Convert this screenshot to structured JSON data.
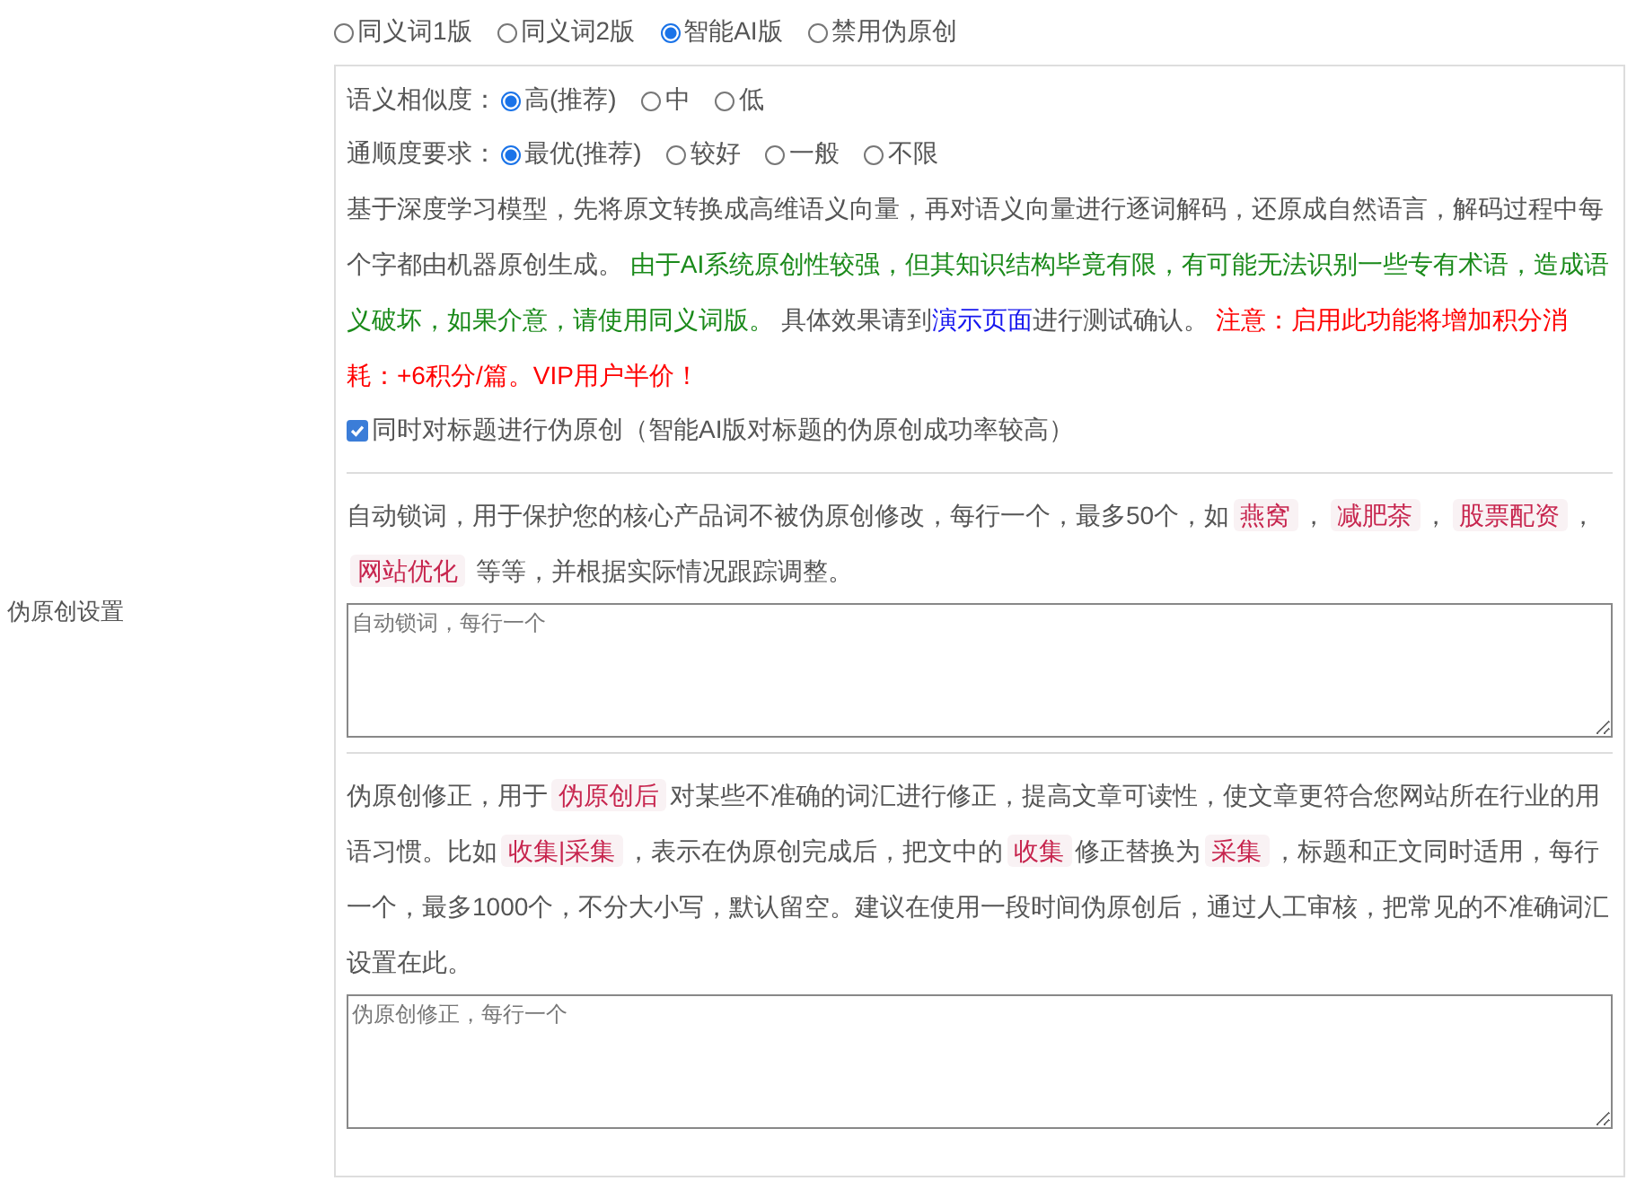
{
  "mode_options": [
    {
      "label": "同义词1版",
      "selected": false
    },
    {
      "label": "同义词2版",
      "selected": false
    },
    {
      "label": "智能AI版",
      "selected": true
    },
    {
      "label": "禁用伪原创",
      "selected": false
    }
  ],
  "section_label": "伪原创设置",
  "similarity": {
    "label": "语义相似度：",
    "options": [
      {
        "label": "高(推荐)",
        "selected": true
      },
      {
        "label": "中",
        "selected": false
      },
      {
        "label": "低",
        "selected": false
      }
    ]
  },
  "fluency": {
    "label": "通顺度要求：",
    "options": [
      {
        "label": "最优(推荐)",
        "selected": true
      },
      {
        "label": "较好",
        "selected": false
      },
      {
        "label": "一般",
        "selected": false
      },
      {
        "label": "不限",
        "selected": false
      }
    ]
  },
  "description": [
    {
      "kind": "plain",
      "text": "基于深度学习模型，先将原文转换成高维语义向量，再对语义向量进行逐词解码，还原成自然语言，解码过程中每个字都由机器原创生成。 "
    },
    {
      "kind": "notice",
      "text": "由于AI系统原创性较强，但其知识结构毕竟有限，有可能无法识别一些专有术语，造成语义破坏，如果介意，请使用同义词版。"
    },
    {
      "kind": "plain",
      "text": " 具体效果请到"
    },
    {
      "kind": "link",
      "text": "演示页面"
    },
    {
      "kind": "plain",
      "text": "进行测试确认。 "
    },
    {
      "kind": "warning",
      "text": "注意：启用此功能将增加积分消耗：+6积分/篇。VIP用户半价！"
    }
  ],
  "title_option": {
    "label": "同时对标题进行伪原创（智能AI版对标题的伪原创成功率较高）",
    "checked": true
  },
  "lock_words": {
    "description": [
      {
        "kind": "plain",
        "text": "自动锁词，用于保护您的核心产品词不被伪原创修改，每行一个，最多50个，如"
      },
      {
        "kind": "code",
        "text": "燕窝"
      },
      {
        "kind": "plain",
        "text": "，"
      },
      {
        "kind": "code",
        "text": "减肥茶"
      },
      {
        "kind": "plain",
        "text": "，"
      },
      {
        "kind": "code",
        "text": "股票配资"
      },
      {
        "kind": "plain",
        "text": "，"
      },
      {
        "kind": "code",
        "text": "网站优化"
      },
      {
        "kind": "plain",
        "text": " 等等，并根据实际情况跟踪调整。"
      }
    ],
    "placeholder": "自动锁词，每行一个"
  },
  "correction": {
    "description": [
      {
        "kind": "plain",
        "text": "伪原创修正，用于"
      },
      {
        "kind": "code",
        "text": "伪原创后"
      },
      {
        "kind": "plain",
        "text": "对某些不准确的词汇进行修正，提高文章可读性，使文章更符合您网站所在行业的用语习惯。比如"
      },
      {
        "kind": "code",
        "text": "收集|采集"
      },
      {
        "kind": "plain",
        "text": "，表示在伪原创完成后，把文中的"
      },
      {
        "kind": "code",
        "text": "收集"
      },
      {
        "kind": "plain",
        "text": "修正替换为"
      },
      {
        "kind": "code",
        "text": "采集"
      },
      {
        "kind": "plain",
        "text": "，标题和正文同时适用，每行一个，最多1000个，不分大小写，默认留空。建议在使用一段时间伪原创后，通过人工审核，把常见的不准确词汇设置在此。"
      }
    ],
    "placeholder": "伪原创修正，每行一个"
  }
}
